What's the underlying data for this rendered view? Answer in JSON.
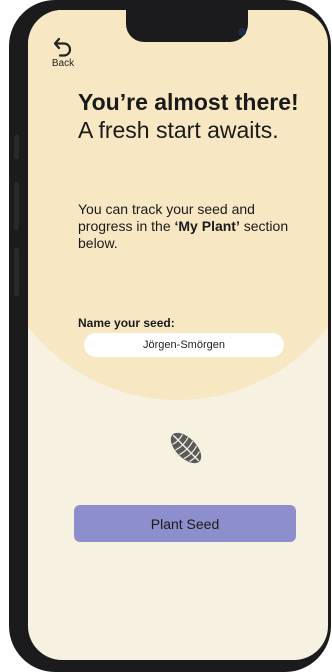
{
  "nav": {
    "back_label": "Back",
    "back_icon": "undo-arrow-icon"
  },
  "hero": {
    "headline_bold": "You’re almost there!",
    "headline_rest": " A fresh start awaits.",
    "desc_pre": "You can track your seed and progress in the ",
    "desc_bold": "‘My Plant’",
    "desc_post": " section below."
  },
  "form": {
    "name_label": "Name your seed:",
    "name_value": "Jörgen-Smörgen"
  },
  "seed_icon": "cacao-seed-icon",
  "action": {
    "plant_label": "Plant Seed"
  },
  "colors": {
    "background": "#f6f1e0",
    "header_blob": "#f7e8c3",
    "button": "#8c8fcb",
    "seed": "#5a5a5a"
  }
}
